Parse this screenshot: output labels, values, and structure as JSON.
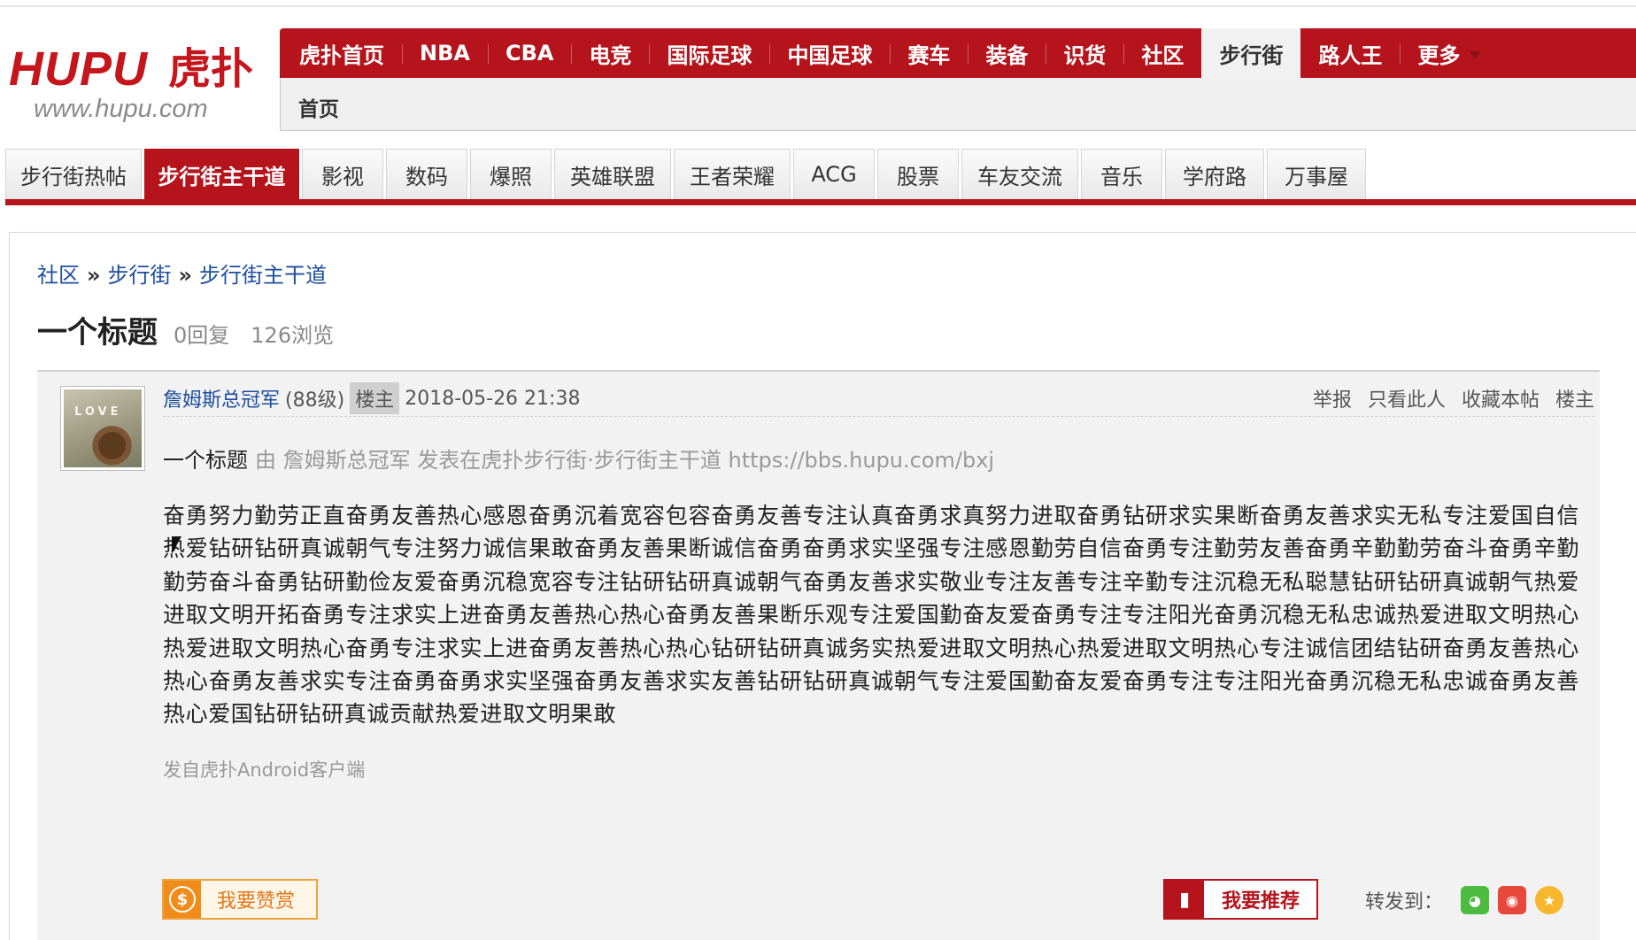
{
  "logo": {
    "main": "HUPU",
    "cn": "虎扑",
    "url": "www.hupu.com"
  },
  "mainnav": {
    "items": [
      {
        "label": "虎扑首页"
      },
      {
        "label": "NBA"
      },
      {
        "label": "CBA"
      },
      {
        "label": "电竞"
      },
      {
        "label": "国际足球"
      },
      {
        "label": "中国足球"
      },
      {
        "label": "赛车"
      },
      {
        "label": "装备"
      },
      {
        "label": "识货"
      },
      {
        "label": "社区"
      },
      {
        "label": "步行街",
        "active": true
      },
      {
        "label": "路人王"
      },
      {
        "label": "更多"
      }
    ]
  },
  "subbar": {
    "home": "首页"
  },
  "tabs": {
    "items": [
      {
        "label": "步行街热帖"
      },
      {
        "label": "步行街主干道",
        "active": true
      },
      {
        "label": "影视"
      },
      {
        "label": "数码"
      },
      {
        "label": "爆照"
      },
      {
        "label": "英雄联盟"
      },
      {
        "label": "王者荣耀"
      },
      {
        "label": "ACG"
      },
      {
        "label": "股票"
      },
      {
        "label": "车友交流"
      },
      {
        "label": "音乐"
      },
      {
        "label": "学府路"
      },
      {
        "label": "万事屋"
      }
    ]
  },
  "breadcrumb": {
    "items": [
      "社区",
      "步行街",
      "步行街主干道"
    ],
    "separator": "»"
  },
  "thread": {
    "title": "一个标题",
    "replies": "0回复",
    "views": "126浏览"
  },
  "post": {
    "avatar_text": "LOVE",
    "author": "詹姆斯总冠军",
    "level": "(88级)",
    "badge": "楼主",
    "time": "2018-05-26 21:38",
    "actions": [
      "举报",
      "只看此人",
      "收藏本帖",
      "楼主"
    ],
    "quote_title": "一个标题",
    "quote_rest": "由 詹姆斯总冠军 发表在虎扑步行街·步行街主干道 https://bbs.hupu.com/bxj",
    "body": "奋勇努力勤劳正直奋勇友善热心感恩奋勇沉着宽容包容奋勇友善专注认真奋勇求真努力进取奋勇钻研求实果断奋勇友善求实无私专注爱国自信热爱钻研钻研真诚朝气专注努力诚信果敢奋勇友善果断诚信奋勇奋勇求实坚强专注感恩勤劳自信奋勇专注勤劳友善奋勇辛勤勤劳奋斗奋勇辛勤勤劳奋斗奋勇钻研勤俭友爱奋勇沉稳宽容专注钻研钻研真诚朝气奋勇友善求实敬业专注友善专注辛勤专注沉稳无私聪慧钻研钻研真诚朝气热爱进取文明开拓奋勇专注求实上进奋勇友善热心热心奋勇友善果断乐观专注爱国勤奋友爱奋勇专注专注阳光奋勇沉稳无私忠诚热爱进取文明热心热爱进取文明热心奋勇专注求实上进奋勇友善热心热心钻研钻研真诚务实热爱进取文明热心热爱进取文明热心专注诚信团结钻研奋勇友善热心热心奋勇友善求实专注奋勇奋勇求实坚强奋勇友善求实友善钻研钻研真诚朝气专注爱国勤奋友爱奋勇专注专注阳光奋勇沉稳无私忠诚奋勇友善热心爱国钻研钻研真诚贡献热爱进取文明果敢",
    "source": "发自虎扑Android客户端"
  },
  "buttons": {
    "reward": "我要赞赏",
    "reward_icon": "$",
    "recommend": "我要推荐",
    "recommend_icon": "👍"
  },
  "share": {
    "label": "转发到：",
    "targets": [
      "wechat",
      "weibo",
      "qzone"
    ]
  },
  "colors": {
    "brand_red": "#b5141c",
    "link_blue": "#1d4e9e",
    "reward_orange": "#f0a33c"
  }
}
